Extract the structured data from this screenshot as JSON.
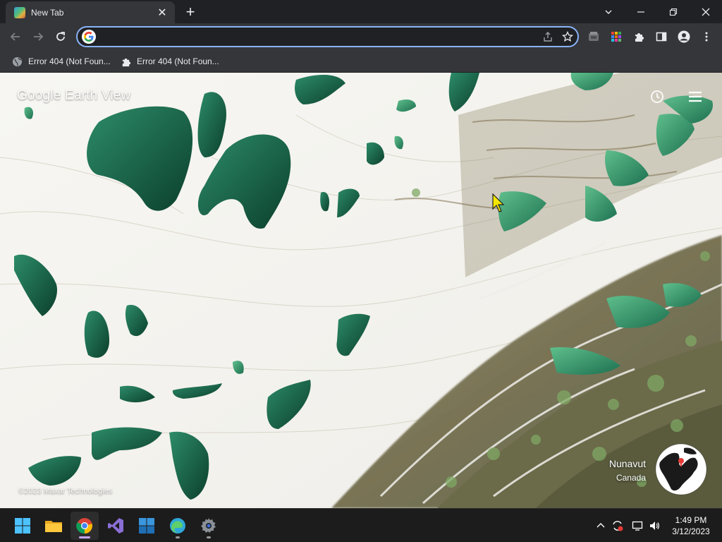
{
  "browser": {
    "tab": {
      "title": "New Tab",
      "close_glyph": "✕",
      "favicon": "earth-view-favicon"
    },
    "new_tab_glyph": "+",
    "window_controls": [
      "chevron-down-icon",
      "minimize-icon",
      "restore-icon",
      "close-icon"
    ],
    "omnibox": {
      "value": "",
      "placeholder": ""
    },
    "bookmarks": [
      {
        "label": "Error 404 (Not Foun...",
        "icon": "globe-icon"
      },
      {
        "label": "Error 404 (Not Foun...",
        "icon": "puzzle-icon"
      }
    ],
    "accent_color": "#8ab4f8"
  },
  "earth_view": {
    "logo": "Google Earth View",
    "credit": "©2023 Maxar Technologies",
    "location": {
      "region": "Nunavut",
      "country": "Canada"
    }
  },
  "taskbar": {
    "apps": [
      "windows-start-icon",
      "file-explorer-icon",
      "chrome-icon",
      "visual-studio-icon",
      "windows-store-icon",
      "edge-icon",
      "settings-icon"
    ],
    "clock": {
      "time": "1:49 PM",
      "date": "3/12/2023"
    }
  }
}
